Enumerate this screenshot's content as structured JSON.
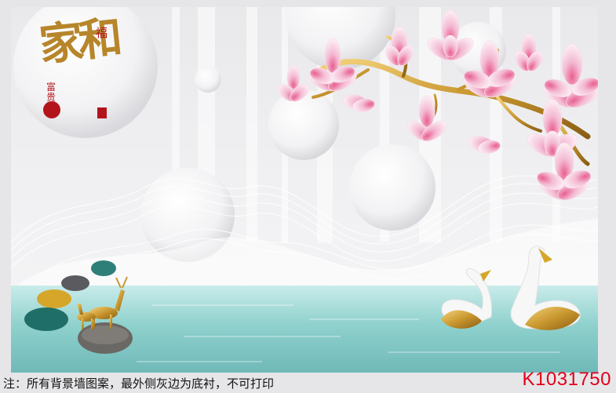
{
  "artwork": {
    "calligraphy_main": "家和",
    "calligraphy_small": "福",
    "seal_text": "富贵",
    "colors": {
      "gold": "#c9972f",
      "blossom": "#f3b9d2",
      "water": "#8fd1cd",
      "background": "#ececee"
    }
  },
  "footer": {
    "note": "注：所有背景墙图案，最外侧灰边为底衬，不可打印",
    "product_code": "K1031750",
    "code_color": "#e3001b"
  }
}
